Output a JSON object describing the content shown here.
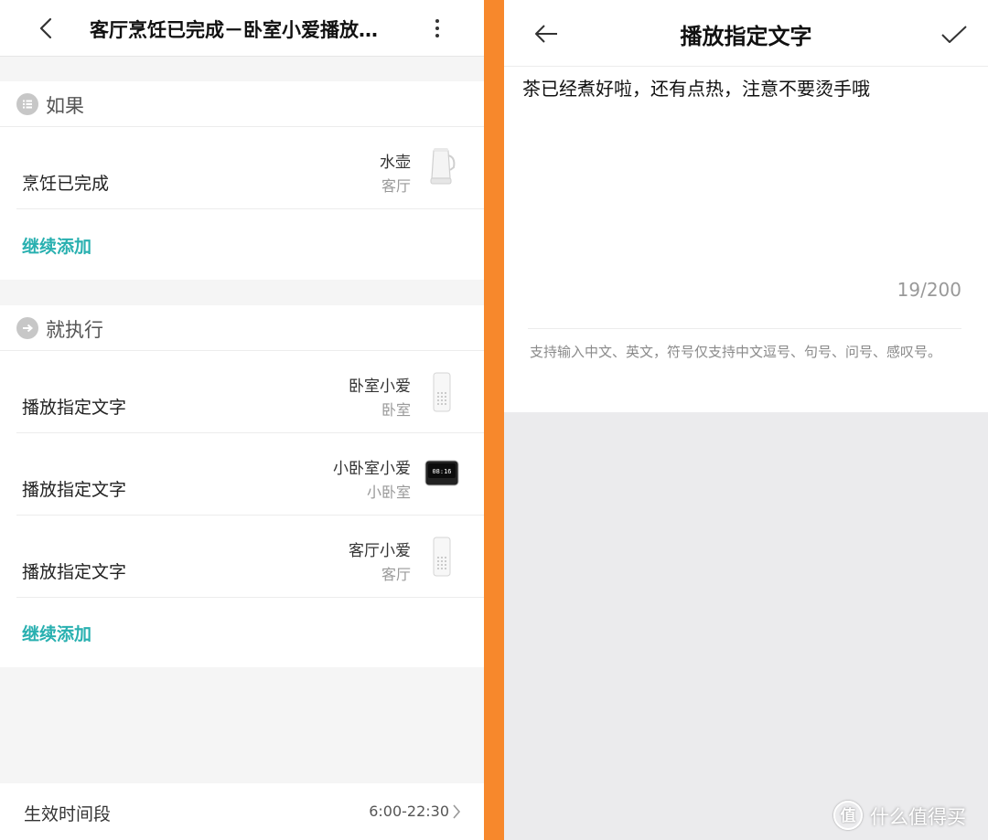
{
  "left": {
    "title": "客厅烹饪已完成－卧室小爱播放…",
    "if_section": {
      "label": "如果",
      "rows": [
        {
          "label": "烹饪已完成",
          "device": "水壶",
          "room": "客厅",
          "icon": "kettle-icon"
        }
      ],
      "add_label": "继续添加"
    },
    "then_section": {
      "label": "就执行",
      "rows": [
        {
          "label": "播放指定文字",
          "device": "卧室小爱",
          "room": "卧室",
          "icon": "speaker-icon"
        },
        {
          "label": "播放指定文字",
          "device": "小卧室小爱",
          "room": "小卧室",
          "icon": "smart-display-icon",
          "display_time": "08:16"
        },
        {
          "label": "播放指定文字",
          "device": "客厅小爱",
          "room": "客厅",
          "icon": "speaker-icon"
        }
      ],
      "add_label": "继续添加"
    },
    "footer": {
      "label": "生效时间段",
      "value": "6:00-22:30"
    }
  },
  "right": {
    "title": "播放指定文字",
    "text_value": "茶已经煮好啦，还有点热，注意不要烫手哦",
    "counter": "19/200",
    "hint": "支持输入中文、英文，符号仅支持中文逗号、句号、问号、感叹号。",
    "watermark": "什么值得买",
    "watermark_glyph": "值"
  },
  "colors": {
    "accent": "#29b0b0",
    "divider_strip": "#f7882c",
    "background": "#f5f5f5"
  }
}
